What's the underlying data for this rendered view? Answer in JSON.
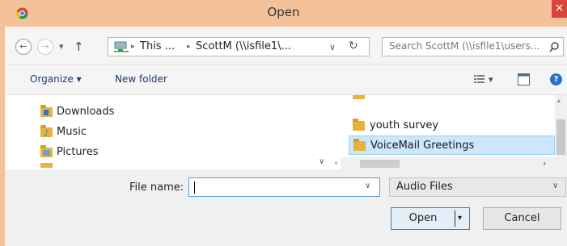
{
  "window": {
    "title": "Open",
    "close_glyph": "×",
    "icon": "chrome-icon"
  },
  "nav": {
    "back_glyph": "←",
    "forward_glyph": "→",
    "recent_glyph": "▾",
    "up_glyph": "↑",
    "address": {
      "icon": "network-drive-icon",
      "segments": [
        "This ...",
        "ScottM (\\\\isfile1\\..."
      ],
      "separator": "▸",
      "dropdown_glyph": "∨",
      "refresh_glyph": "↻"
    },
    "search": {
      "placeholder": "Search ScottM (\\\\isfile1\\users...",
      "icon": "search-icon"
    }
  },
  "toolbar": {
    "organize_label": "Organize ▾",
    "new_folder_label": "New folder",
    "view_glyph": "▾",
    "help_glyph": "?"
  },
  "nav_pane": {
    "items": [
      {
        "label": "Downloads",
        "icon": "downloads-folder-icon"
      },
      {
        "label": "Music",
        "icon": "music-folder-icon"
      },
      {
        "label": "Pictures",
        "icon": "pictures-folder-icon"
      }
    ]
  },
  "file_list": {
    "items": [
      {
        "label": "youth survey",
        "icon": "folder-icon",
        "selected": false
      },
      {
        "label": "VoiceMail Greetings",
        "icon": "folder-icon",
        "selected": true
      }
    ]
  },
  "scroll": {
    "collapse_glyph": "∨",
    "left_glyph": "‹",
    "right_glyph": "›"
  },
  "bottom": {
    "file_name_label": "File name:",
    "file_name_value": "",
    "dropdown_glyph": "∨",
    "filter_value": "Audio Files",
    "open_label": "Open",
    "open_arrow": "▾",
    "cancel_label": "Cancel"
  },
  "colors": {
    "title_bar": "#f3c29a",
    "close_button": "#d9443c",
    "selection": "#cce6fb",
    "folder": "#e8b33c"
  }
}
